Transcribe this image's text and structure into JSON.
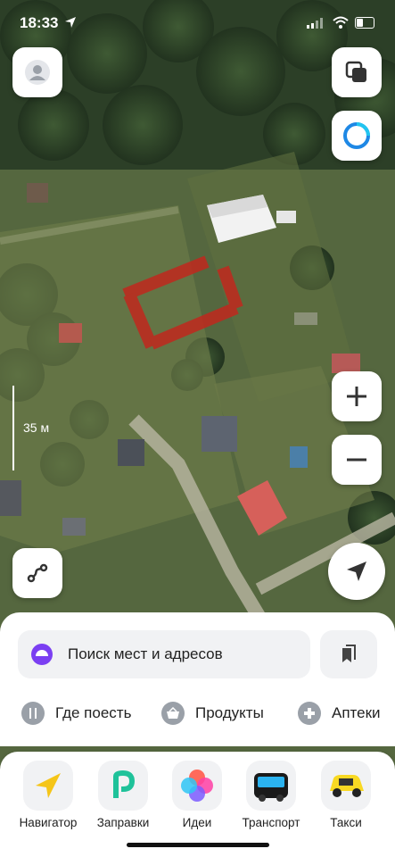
{
  "status_bar": {
    "time": "18:33"
  },
  "map": {
    "scale_label": "35 м",
    "highlight_color": "#c0281e"
  },
  "search": {
    "placeholder": "Поиск мест и адресов"
  },
  "chips": [
    {
      "label": "Где поесть",
      "icon": "fork-knife-icon"
    },
    {
      "label": "Продукты",
      "icon": "basket-icon"
    },
    {
      "label": "Аптеки",
      "icon": "pharmacy-cross-icon"
    }
  ],
  "apps": [
    {
      "label": "Навигатор",
      "icon": "navigator-icon"
    },
    {
      "label": "Заправки",
      "icon": "gas-station-icon"
    },
    {
      "label": "Идеи",
      "icon": "ideas-icon"
    },
    {
      "label": "Транспорт",
      "icon": "bus-icon"
    },
    {
      "label": "Такси",
      "icon": "taxi-icon"
    }
  ],
  "colors": {
    "accent": "#1e88e5",
    "alice": "#7b3ff2",
    "sheet": "#ffffff"
  }
}
